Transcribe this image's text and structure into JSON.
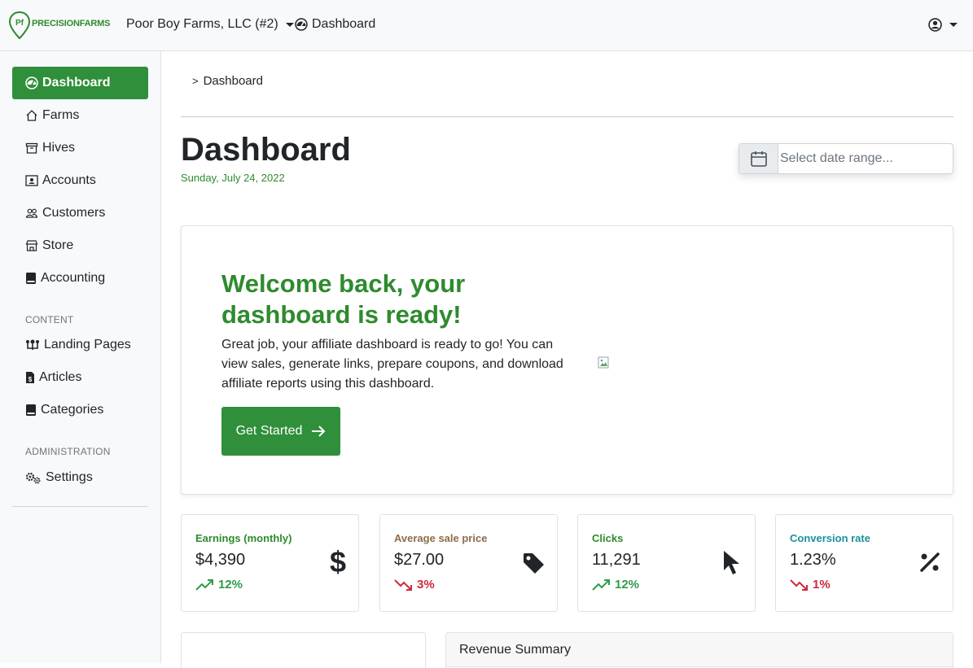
{
  "topbar": {
    "logo_text": "PRECISIONFARMS",
    "logo_mark": "Pf",
    "farm": "Poor Boy Farms, LLC (#2)",
    "current_page": "Dashboard"
  },
  "sidebar": {
    "items": [
      {
        "label": "Dashboard",
        "icon": "gauge-icon"
      },
      {
        "label": "Farms",
        "icon": "house-icon"
      },
      {
        "label": "Hives",
        "icon": "archive-icon"
      },
      {
        "label": "Accounts",
        "icon": "person-card-icon"
      },
      {
        "label": "Customers",
        "icon": "people-icon"
      },
      {
        "label": "Store",
        "icon": "shop-icon"
      },
      {
        "label": "Accounting",
        "icon": "book-icon"
      }
    ],
    "content_heading": "CONTENT",
    "content_items": [
      {
        "label": "Landing Pages",
        "icon": "network-icon"
      },
      {
        "label": "Articles",
        "icon": "file-dollar-icon"
      },
      {
        "label": "Categories",
        "icon": "book-icon"
      }
    ],
    "admin_heading": "ADMINISTRATION",
    "admin_items": [
      {
        "label": "Settings",
        "icon": "gears-icon"
      }
    ]
  },
  "breadcrumb": {
    "separator": ">",
    "current": "Dashboard"
  },
  "page": {
    "title": "Dashboard",
    "date": "Sunday, July 24, 2022"
  },
  "date_range": {
    "placeholder": "Select date range..."
  },
  "welcome": {
    "title": "Welcome back, your dashboard is ready!",
    "text": "Great job, your affiliate dashboard is ready to go! You can view sales, generate links, prepare coupons, and download affiliate reports using this dashboard.",
    "button_label": "Get Started"
  },
  "stats": [
    {
      "label": "Earnings (monthly)",
      "value": "$4,390",
      "trend": "12%",
      "direction": "up",
      "label_color": "#2e8b2e",
      "icon": "dollar-icon"
    },
    {
      "label": "Average sale price",
      "value": "$27.00",
      "trend": "3%",
      "direction": "down",
      "label_color": "#8c6d46",
      "icon": "tag-icon"
    },
    {
      "label": "Clicks",
      "value": "11,291",
      "trend": "12%",
      "direction": "up",
      "label_color": "#2e8b2e",
      "icon": "cursor-icon"
    },
    {
      "label": "Conversion rate",
      "value": "1.23%",
      "trend": "1%",
      "direction": "down",
      "label_color": "#1b8fa0",
      "icon": "percent-icon"
    }
  ],
  "revenue": {
    "title": "Revenue Summary"
  },
  "colors": {
    "brand_green": "#2f8f3a",
    "up": "#2e9b4a",
    "down": "#d0263d"
  }
}
